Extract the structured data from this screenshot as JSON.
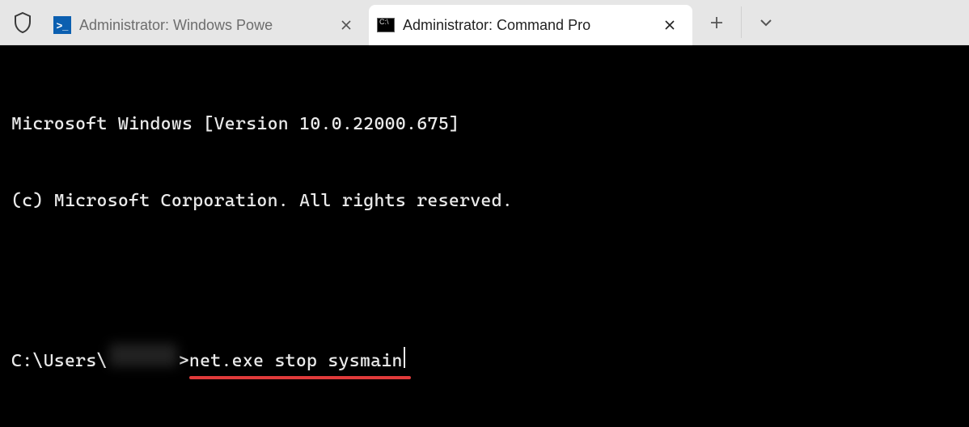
{
  "tabbar": {
    "tabs": [
      {
        "title": "Administrator: Windows Powe",
        "icon": "powershell-icon",
        "active": false
      },
      {
        "title": "Administrator: Command Pro",
        "icon": "cmd-icon",
        "active": true
      }
    ],
    "new_tab_label": "+",
    "dropdown_label": "⌄"
  },
  "terminal": {
    "line1": "Microsoft Windows [Version 10.0.22000.675]",
    "line2": "(c) Microsoft Corporation. All rights reserved.",
    "prompt_prefix": "C:\\Users\\",
    "prompt_suffix": ">",
    "command": "net.exe stop sysmain"
  },
  "annotation": {
    "underline_color": "#e03a3a"
  }
}
